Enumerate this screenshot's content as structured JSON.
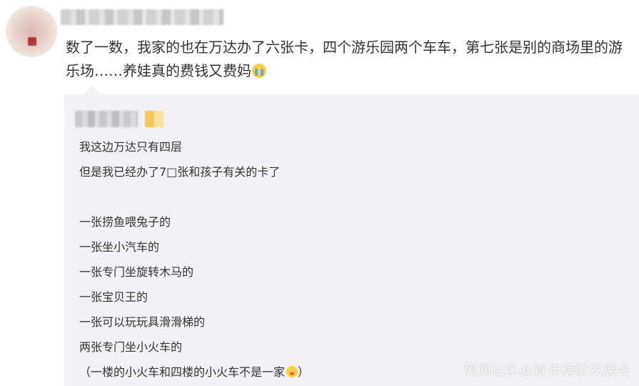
{
  "post": {
    "text": "数了一数，我家的也在万达办了六张卡，四个游乐园两个车车，第七张是别的商场里的游乐场……养娃真的费钱又费妈",
    "emoji": "crying-face-emoji"
  },
  "reply": {
    "lines": [
      "我这边万达只有四层",
      "但是我已经办了7□张和孩子有关的卡了",
      "",
      "一张捞鱼喂兔子的",
      "一张坐小汽车的",
      "一张专门坐旋转木马的",
      "一张宝贝王的",
      "一张可以玩玩具滑滑梯的",
      "两张专门坐小火车的"
    ],
    "last_line_open": "（一楼的小火车和四楼的小火车不是一家",
    "last_line_close": "）",
    "last_line_emoji": "sad-face-emoji"
  },
  "watermark": "风闻社区@青年榜财发展会",
  "colors": {
    "quote_bg": "#f2f2f5",
    "text": "#333333"
  }
}
